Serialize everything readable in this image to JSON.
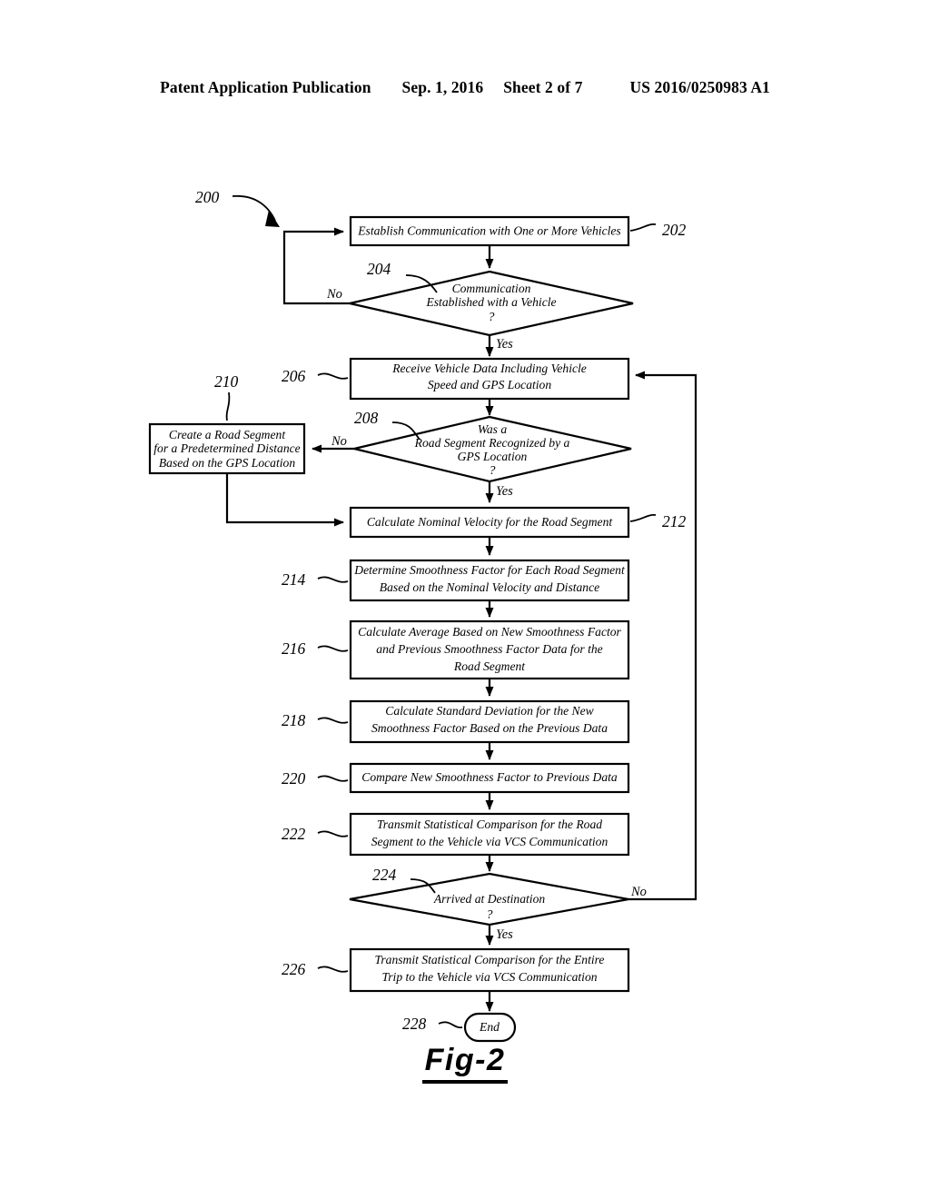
{
  "header": {
    "publication": "Patent Application Publication",
    "date": "Sep. 1, 2016",
    "sheet": "Sheet 2 of 7",
    "number": "US 2016/0250983 A1"
  },
  "figure": {
    "caption": "Fig-2",
    "diagram_ref": "200"
  },
  "chart_data": {
    "type": "diagram",
    "title": "Fig-2",
    "diagram_kind": "flowchart",
    "diagram_number": "200",
    "nodes": [
      {
        "ref": "202",
        "shape": "process",
        "text": "Establish Communication with One or More Vehicles"
      },
      {
        "ref": "204",
        "shape": "decision",
        "text": "Communication Established with a Vehicle ?"
      },
      {
        "ref": "206",
        "shape": "process",
        "text": "Receive Vehicle Data Including Vehicle Speed and GPS Location"
      },
      {
        "ref": "208",
        "shape": "decision",
        "text": "Was a Road Segment Recognized by a GPS Location ?"
      },
      {
        "ref": "210",
        "shape": "process",
        "text": "Create a Road Segment for a Predetermined Distance Based on the GPS Location"
      },
      {
        "ref": "212",
        "shape": "process",
        "text": "Calculate Nominal Velocity for the Road Segment"
      },
      {
        "ref": "214",
        "shape": "process",
        "text": "Determine Smoothness Factor for Each Road Segment Based on the Nominal Velocity and Distance"
      },
      {
        "ref": "216",
        "shape": "process",
        "text": "Calculate Average Based on New Smoothness Factor and Previous Smoothness Factor Data for the Road Segment"
      },
      {
        "ref": "218",
        "shape": "process",
        "text": "Calculate Standard Deviation for the New Smoothness Factor Based on the Previous Data"
      },
      {
        "ref": "220",
        "shape": "process",
        "text": "Compare New Smoothness Factor to Previous Data"
      },
      {
        "ref": "222",
        "shape": "process",
        "text": "Transmit Statistical Comparison for the Road Segment to the Vehicle via VCS Communication"
      },
      {
        "ref": "224",
        "shape": "decision",
        "text": "Arrived at Destination ?"
      },
      {
        "ref": "226",
        "shape": "process",
        "text": "Transmit Statistical Comparison for the Entire Trip to the Vehicle via VCS Communication"
      },
      {
        "ref": "228",
        "shape": "terminator",
        "text": "End"
      }
    ],
    "edges": [
      {
        "from": "202",
        "to": "204",
        "label": ""
      },
      {
        "from": "204",
        "to": "202",
        "label": "No"
      },
      {
        "from": "204",
        "to": "206",
        "label": "Yes"
      },
      {
        "from": "206",
        "to": "208",
        "label": ""
      },
      {
        "from": "208",
        "to": "210",
        "label": "No"
      },
      {
        "from": "208",
        "to": "212",
        "label": "Yes"
      },
      {
        "from": "210",
        "to": "212",
        "label": ""
      },
      {
        "from": "212",
        "to": "214",
        "label": ""
      },
      {
        "from": "214",
        "to": "216",
        "label": ""
      },
      {
        "from": "216",
        "to": "218",
        "label": ""
      },
      {
        "from": "218",
        "to": "220",
        "label": ""
      },
      {
        "from": "220",
        "to": "222",
        "label": ""
      },
      {
        "from": "222",
        "to": "224",
        "label": ""
      },
      {
        "from": "224",
        "to": "206",
        "label": "No"
      },
      {
        "from": "224",
        "to": "226",
        "label": "Yes"
      },
      {
        "from": "226",
        "to": "228",
        "label": ""
      }
    ]
  },
  "nodes": {
    "n202": {
      "ref": "202",
      "line1": "Establish Communication with One or More Vehicles"
    },
    "n204": {
      "ref": "204",
      "line1": "Communication",
      "line2": "Established with a Vehicle",
      "line3": "?"
    },
    "n206": {
      "ref": "206",
      "line1": "Receive Vehicle Data Including Vehicle",
      "line2": "Speed and GPS Location"
    },
    "n208": {
      "ref": "208",
      "line1": "Was a",
      "line2": "Road Segment Recognized by a",
      "line3": "GPS Location",
      "line4": "?"
    },
    "n210": {
      "ref": "210",
      "line1": "Create a Road Segment",
      "line2": "for a Predetermined Distance",
      "line3": "Based on the GPS Location"
    },
    "n212": {
      "ref": "212",
      "line1": "Calculate Nominal Velocity for the Road Segment"
    },
    "n214": {
      "ref": "214",
      "line1": "Determine Smoothness Factor for Each Road Segment",
      "line2": "Based on the Nominal Velocity and Distance"
    },
    "n216": {
      "ref": "216",
      "line1": "Calculate Average Based on New Smoothness Factor",
      "line2": "and Previous Smoothness Factor Data for the",
      "line3": "Road Segment"
    },
    "n218": {
      "ref": "218",
      "line1": "Calculate Standard Deviation for the New",
      "line2": "Smoothness Factor Based on the Previous Data"
    },
    "n220": {
      "ref": "220",
      "line1": "Compare New Smoothness Factor to Previous Data"
    },
    "n222": {
      "ref": "222",
      "line1": "Transmit Statistical Comparison for the Road",
      "line2": "Segment to the Vehicle via VCS Communication"
    },
    "n224": {
      "ref": "224",
      "line1": "Arrived at Destination",
      "line2": "?"
    },
    "n226": {
      "ref": "226",
      "line1": "Transmit Statistical Comparison for the Entire",
      "line2": "Trip to the Vehicle via VCS Communication"
    },
    "n228": {
      "ref": "228",
      "line1": "End"
    }
  },
  "branches": {
    "no_204": "No",
    "yes_204": "Yes",
    "no_208": "No",
    "yes_208": "Yes",
    "no_224": "No",
    "yes_224": "Yes"
  }
}
